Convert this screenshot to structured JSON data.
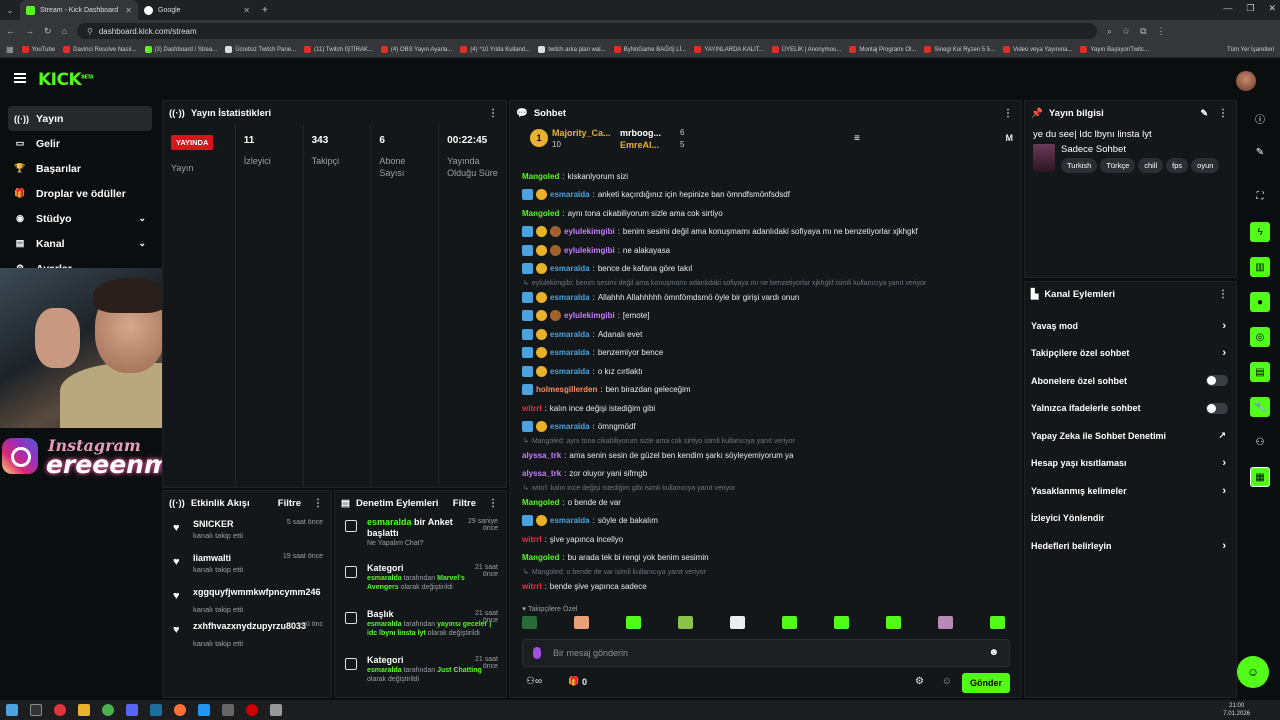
{
  "browser": {
    "tabs": [
      {
        "title": "Stream - Kick Dashboard",
        "active": true
      },
      {
        "title": "Google",
        "active": false
      }
    ],
    "url": "dashboard.kick.com/stream",
    "bookmarks": [
      "YouTube",
      "Davinci Resolve Nasıl...",
      "(3) Dashboard / Strea...",
      "Ücretsiz Twitch Pane...",
      "(11) Twitch İŞTİRAK...",
      "(4) OBS Yayın Ayarla...",
      "(4) *10 Yılda Kulland...",
      "twitch arka plan wal...",
      "ByNoGame BAĞIŞ Lİ...",
      "YAYINLARDA KALIT...",
      "ÜYELİK | Anonymou...",
      "Montaj Programı Ol...",
      "Sinegi Koi Ryzen 5 5...",
      "Video veya Yayınına...",
      "Yayın Başlıyor/Twitc..."
    ],
    "all_bookmarks": "Tüm Yer İşaretleri"
  },
  "header": {
    "logo": "KICK",
    "logo_sup": "BETA"
  },
  "nav": [
    {
      "label": "Yayın",
      "icon": "broadcast-icon",
      "glyph": "((·))",
      "active": true,
      "chevron": false
    },
    {
      "label": "Gelir",
      "icon": "revenue-icon",
      "glyph": "▭",
      "active": false,
      "chevron": false
    },
    {
      "label": "Başarılar",
      "icon": "trophy-icon",
      "glyph": "🏆",
      "active": false,
      "chevron": false
    },
    {
      "label": "Droplar ve ödüller",
      "icon": "gift-icon",
      "glyph": "🎁",
      "active": false,
      "chevron": false
    },
    {
      "label": "Stüdyo",
      "icon": "studio-icon",
      "glyph": "◉",
      "active": false,
      "chevron": true
    },
    {
      "label": "Kanal",
      "icon": "channel-icon",
      "glyph": "▤",
      "active": false,
      "chevron": true
    },
    {
      "label": "Ayarlar",
      "icon": "settings-icon",
      "glyph": "⚙",
      "active": false,
      "chevron": true
    }
  ],
  "overlay": {
    "line1": "Instagram",
    "line2": "ereeenmise"
  },
  "stats": {
    "title": "Yayın İstatistikleri",
    "live_label": "YAYINDA",
    "live_sub": "Yayın",
    "items": [
      {
        "value": "11",
        "label": "İzleyici"
      },
      {
        "value": "343",
        "label": "Takipçi"
      },
      {
        "value": "6",
        "label": "Abone Sayısı"
      },
      {
        "value": "00:22:45",
        "label": "Yayında Olduğu Süre"
      }
    ]
  },
  "activity": {
    "title": "Etkinlik Akışı",
    "filter": "Filtre",
    "items": [
      {
        "name": "SNICKER",
        "sub": "kanalı takip etti",
        "time": "5 saat önce"
      },
      {
        "name": "liamwalti",
        "sub": "kanalı takip etti",
        "time": "19 saat önce"
      },
      {
        "name": "xggquyfjwmmkwfpncymm246",
        "sub": "kanalı takip etti",
        "time": ""
      },
      {
        "name": "zxhfhvazxnydzupyrzu8033",
        "sub": "kanalı takip etti",
        "time": "gü önc"
      }
    ]
  },
  "moderation": {
    "title": "Denetim Eylemleri",
    "filter": "Filtre",
    "items": [
      {
        "user": "esmaralda",
        "title": " bir Anket başlattı",
        "time": "29 saniye önce",
        "desc": "Ne Yapalım Chat?"
      },
      {
        "user": "",
        "title": "Kategori",
        "time": "21 saat önce",
        "desc_user": "esmaralda",
        "desc_mid": " tarafından ",
        "desc_val": "Marvel's Avengers",
        "desc_end": " olarak değiştirildi"
      },
      {
        "user": "",
        "title": "Başlık",
        "time": "21 saat önce",
        "desc_user": "esmaralda",
        "desc_mid": " tarafından ",
        "desc_val": "yayınsı geceler | idc lbynı linsta lyt",
        "desc_end": " olarak değiştirildi"
      },
      {
        "user": "",
        "title": "Kategori",
        "time": "21 saat önce",
        "desc_user": "esmaralda",
        "desc_mid": " tarafından ",
        "desc_val": "Just Chatting",
        "desc_end": " olarak değiştirildi"
      }
    ]
  },
  "chat": {
    "title": "Sohbet",
    "pinned": [
      {
        "name": "Majority_Ca...",
        "count": "10"
      },
      {
        "name": "mrboog...",
        "count": "6"
      },
      {
        "name": "EmreAl...",
        "count": "5"
      }
    ],
    "messages": [
      {
        "type": "msg",
        "user": "Mangoled",
        "color": "#53fc18",
        "badges": [],
        "text": "kiskanlyorum sizi"
      },
      {
        "type": "msg",
        "user": "esmaralda",
        "color": "#4aa3df",
        "badges": [
          "mod",
          "sub"
        ],
        "text": "anketi kaçırdığınız için hepinize ban ömndfsmönfsdsdf"
      },
      {
        "type": "msg",
        "user": "Mangoled",
        "color": "#53fc18",
        "badges": [],
        "text": "aynı tonа cikabiliyorum sizle ama cok sirtiyo"
      },
      {
        "type": "msg",
        "user": "eylulekimgibi",
        "color": "#c77dff",
        "badges": [
          "mod",
          "sub",
          "cookie"
        ],
        "text": "benim sesimi değil ama konuşmamı adanlıdaki sofiyaya mı ne benzetiyorlar xjkhgkf"
      },
      {
        "type": "msg",
        "user": "eylulekimgibi",
        "color": "#c77dff",
        "badges": [
          "mod",
          "sub",
          "cookie"
        ],
        "text": "ne alakayasa"
      },
      {
        "type": "msg",
        "user": "esmaralda",
        "color": "#4aa3df",
        "badges": [
          "mod",
          "sub"
        ],
        "text": "bence de kafana göre takıl"
      },
      {
        "type": "reply",
        "text": "eylulekimgibi: benim sesimi değil ama konuşmamı adanlıdaki sofiyaya mı ne benzetiyorlar xjkhgkf isimli kullanıcıya yanıt veriyor"
      },
      {
        "type": "msg",
        "user": "esmaralda",
        "color": "#4aa3df",
        "badges": [
          "mod",
          "sub"
        ],
        "text": "Allahhh Allahhhhh ömnfömdsmö öyle bir girişi vardı onun"
      },
      {
        "type": "msg",
        "user": "eylulekimgibi",
        "color": "#c77dff",
        "badges": [
          "mod",
          "sub",
          "cookie"
        ],
        "text": "[emote]"
      },
      {
        "type": "msg",
        "user": "esmaralda",
        "color": "#4aa3df",
        "badges": [
          "mod",
          "sub"
        ],
        "text": "Adanalı evet"
      },
      {
        "type": "msg",
        "user": "esmaralda",
        "color": "#4aa3df",
        "badges": [
          "mod",
          "sub"
        ],
        "text": "benzemiyor bence"
      },
      {
        "type": "msg",
        "user": "esmaralda",
        "color": "#4aa3df",
        "badges": [
          "mod",
          "sub"
        ],
        "text": "o kız cırtlaktı"
      },
      {
        "type": "msg",
        "user": "holmesgillerden",
        "color": "#ff8a5c",
        "badges": [
          "mod"
        ],
        "text": "ben birazdan geleceğim"
      },
      {
        "type": "msg",
        "user": "witrrl",
        "color": "#e0333d",
        "badges": [],
        "text": "kalın ince değişi istediğim gibi"
      },
      {
        "type": "msg",
        "user": "esmaralda",
        "color": "#4aa3df",
        "badges": [
          "mod",
          "sub"
        ],
        "text": "ömngmödf"
      },
      {
        "type": "reply",
        "text": "Mangoled: aynı tonа cikabiliyorum sizle ama cok sirtiyo isimli kullanıcıya yanıt veriyor"
      },
      {
        "type": "msg",
        "user": "alyssa_trk",
        "color": "#c77dff",
        "badges": [],
        "text": "ama senin sesin de güzel ben kendim şarkı söyleyemiyorum ya"
      },
      {
        "type": "msg",
        "user": "alyssa_trk",
        "color": "#c77dff",
        "badges": [],
        "text": "zor oluyor yani sifmgb"
      },
      {
        "type": "reply",
        "text": "witrrl: kalın ince değişi istediğim gibi isimli kullanıcıya yanıt veriyor"
      },
      {
        "type": "msg",
        "user": "Mangoled",
        "color": "#53fc18",
        "badges": [],
        "text": "o bende de var"
      },
      {
        "type": "msg",
        "user": "esmaralda",
        "color": "#4aa3df",
        "badges": [
          "mod",
          "sub"
        ],
        "text": "söyle de bakalım"
      },
      {
        "type": "msg",
        "user": "witrrl",
        "color": "#e0333d",
        "badges": [],
        "text": "şive yapınca incellyo"
      },
      {
        "type": "msg",
        "user": "Mangoled",
        "color": "#53fc18",
        "badges": [],
        "text": "bu arada tek bi rengi yok benim sesimin"
      },
      {
        "type": "reply",
        "text": "Mangoled: o bende de var isimli kullanıcıya yanıt veriyor"
      },
      {
        "type": "msg",
        "user": "witrrl",
        "color": "#e0333d",
        "badges": [],
        "text": "bende şive yapınca sadece"
      }
    ],
    "emotes_label": "Takipçilere Özel",
    "input_placeholder": "Bir mesaj gönderin",
    "count": "0",
    "send": "Gönder"
  },
  "info": {
    "title": "Yayın bilgisi",
    "stream_title": "ye du see| Idc lbynı linsta lyt",
    "category": "Sadece Sohbet",
    "tags": [
      "Turkish",
      "Türkçe",
      "chill",
      "fps",
      "oyun"
    ]
  },
  "actions": {
    "title": "Kanal Eylemleri",
    "rows": [
      {
        "label": "Yavaş mod",
        "kind": "chevron"
      },
      {
        "label": "Takipçilere özel sohbet",
        "kind": "chevron"
      },
      {
        "label": "Abonelere özel sohbet",
        "kind": "toggle"
      },
      {
        "label": "Yalnızca ifadelerle sohbet",
        "kind": "toggle"
      },
      {
        "label": "Yapay Zeka ile Sohbet Denetimi",
        "kind": "external"
      },
      {
        "label": "Hesap yaşı kısıtlaması",
        "kind": "chevron"
      },
      {
        "label": "Yasaklanmış kelimeler",
        "kind": "chevron"
      },
      {
        "label": "İzleyici Yönlendir",
        "kind": "none"
      },
      {
        "label": "Hedefleri belirleyin",
        "kind": "chevron"
      }
    ]
  },
  "taskbar": {
    "time": "21:00",
    "date": "7.01.2026"
  },
  "colors": {
    "accent": "#53fc18",
    "live": "#d8151c",
    "panel": "#141719",
    "bg": "#0b0e0f"
  }
}
